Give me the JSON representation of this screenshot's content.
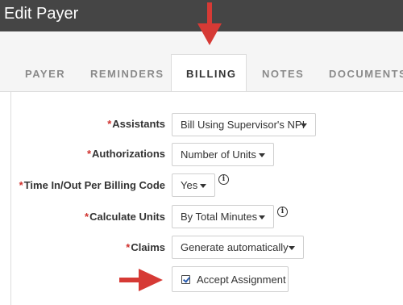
{
  "header": {
    "title": "Edit Payer"
  },
  "tabs": [
    {
      "label": "PAYER",
      "active": false
    },
    {
      "label": "REMINDERS",
      "active": false
    },
    {
      "label": "BILLING",
      "active": true
    },
    {
      "label": "NOTES",
      "active": false
    },
    {
      "label": "DOCUMENTS",
      "active": false
    }
  ],
  "form": {
    "required_marker": "*",
    "assistants": {
      "label": "Assistants",
      "value": "Bill Using Supervisor's NPI"
    },
    "authorizations": {
      "label": "Authorizations",
      "value": "Number of Units"
    },
    "time_in_out": {
      "label": "Time In/Out Per Billing Code",
      "value": "Yes"
    },
    "calculate_units": {
      "label": "Calculate Units",
      "value": "By Total Minutes"
    },
    "claims": {
      "label": "Claims",
      "value": "Generate automatically"
    },
    "accept_assignment": {
      "label": "Accept Assignment",
      "checked": true
    }
  },
  "icons": {
    "info": "info-icon",
    "caret": "chevron-down-icon",
    "checkbox": "checkbox-checked-icon",
    "annotation_arrow_down": "red-arrow-down-icon",
    "annotation_arrow_right": "red-arrow-right-icon"
  },
  "colors": {
    "header_bg": "#454545",
    "required": "#d0312d",
    "annotation_arrow": "#d63a35"
  }
}
